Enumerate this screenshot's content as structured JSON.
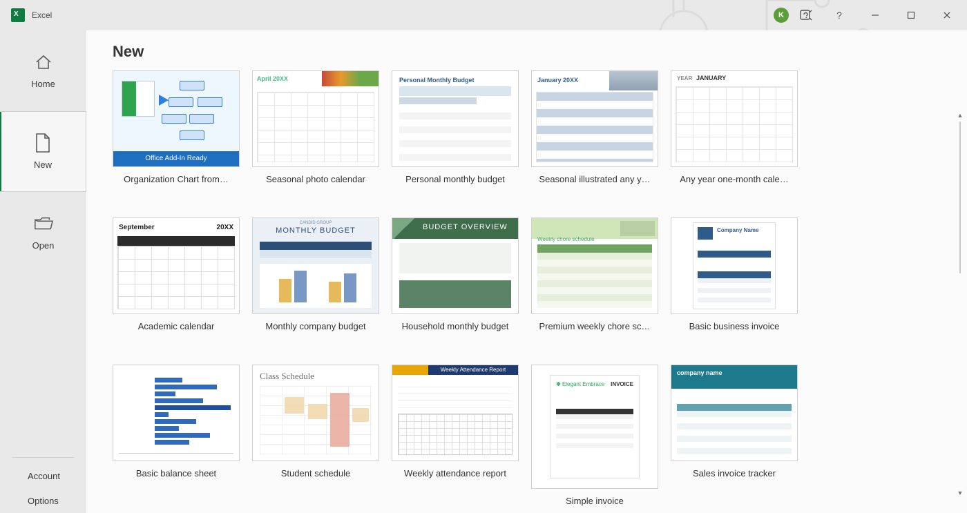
{
  "app": {
    "name": "Excel"
  },
  "user": {
    "initial": "K"
  },
  "window_controls": {
    "help": "?",
    "minimize": "—",
    "restore": "▢",
    "close": "✕"
  },
  "nav": {
    "home": "Home",
    "new": "New",
    "open": "Open",
    "account": "Account",
    "options": "Options"
  },
  "page": {
    "title": "New"
  },
  "templates": [
    {
      "label": "Organization Chart from…",
      "thumb": {
        "type": "orgchart",
        "footer": "Office Add-In Ready"
      }
    },
    {
      "label": "Seasonal photo calendar",
      "thumb": {
        "type": "photo-calendar",
        "month": "April 20XX"
      }
    },
    {
      "label": "Personal monthly budget",
      "thumb": {
        "type": "personal-budget",
        "title": "Personal Monthly Budget"
      }
    },
    {
      "label": "Seasonal illustrated any y…",
      "thumb": {
        "type": "illustrated-calendar",
        "month": "January 20XX"
      }
    },
    {
      "label": "Any year one-month cale…",
      "thumb": {
        "type": "plain-calendar",
        "year": "YEAR",
        "month": "JANUARY"
      }
    },
    {
      "label": "Academic calendar",
      "thumb": {
        "type": "academic-calendar",
        "month": "September",
        "year": "20XX"
      }
    },
    {
      "label": "Monthly company budget",
      "thumb": {
        "type": "company-budget",
        "title": "MONTHLY BUDGET",
        "subtitle": "CANDID GROUP"
      }
    },
    {
      "label": "Household monthly budget",
      "thumb": {
        "type": "household-budget",
        "title": "BUDGET OVERVIEW"
      }
    },
    {
      "label": "Premium weekly chore sc…",
      "thumb": {
        "type": "chore-schedule",
        "title": "Weekly chore schedule"
      }
    },
    {
      "label": "Basic business invoice",
      "thumb": {
        "type": "business-invoice",
        "company": "Company Name"
      }
    },
    {
      "label": "Basic balance sheet",
      "thumb": {
        "type": "balance-sheet"
      }
    },
    {
      "label": "Student schedule",
      "thumb": {
        "type": "student-schedule",
        "title": "Class Schedule"
      }
    },
    {
      "label": "Weekly attendance report",
      "thumb": {
        "type": "attendance",
        "title": "Weekly Attendance Report"
      }
    },
    {
      "label": "Simple invoice",
      "thumb": {
        "type": "simple-invoice",
        "brand": "Elegant Embrace",
        "word": "INVOICE"
      }
    },
    {
      "label": "Sales invoice tracker",
      "thumb": {
        "type": "sales-tracker",
        "company": "company name"
      }
    }
  ]
}
